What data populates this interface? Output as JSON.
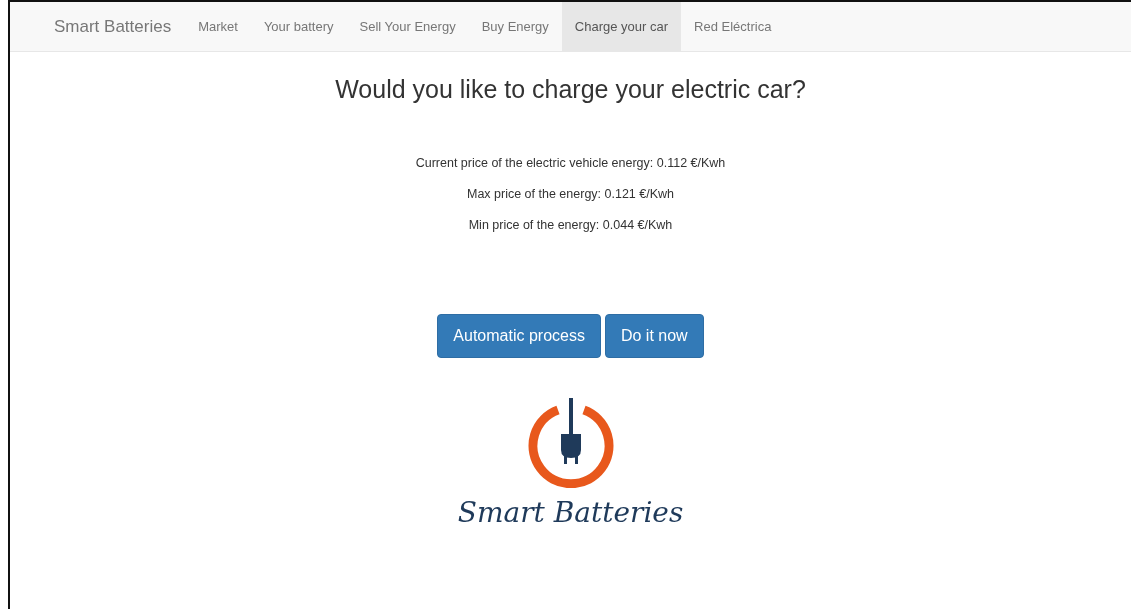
{
  "navbar": {
    "brand": "Smart Batteries",
    "items": [
      {
        "label": "Market",
        "selected": false
      },
      {
        "label": "Your battery",
        "selected": false
      },
      {
        "label": "Sell Your Energy",
        "selected": false
      },
      {
        "label": "Buy Energy",
        "selected": false
      },
      {
        "label": "Charge your car",
        "selected": true
      },
      {
        "label": "Red Eléctrica",
        "selected": false
      }
    ]
  },
  "heading": "Would you like to charge your electric car?",
  "prices": [
    "Current price of the electric vehicle energy: 0.112 €/Kwh",
    "Max price of the energy: 0.121 €/Kwh",
    "Min price of the energy: 0.044 €/Kwh"
  ],
  "buttons": [
    "Automatic process",
    "Do it now"
  ],
  "logo": {
    "text": "Smart Batteries"
  }
}
